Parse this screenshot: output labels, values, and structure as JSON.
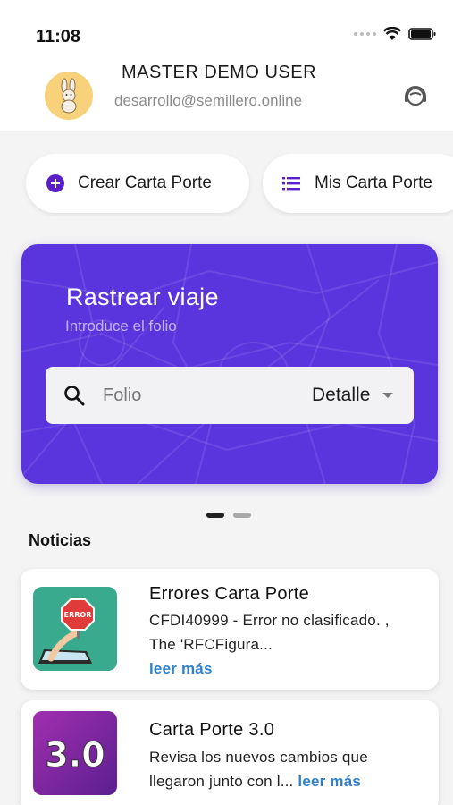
{
  "status_bar": {
    "time": "11:08"
  },
  "user": {
    "name": "MASTER DEMO USER",
    "email": "desarrollo@semillero.online"
  },
  "actions": {
    "create_label": "Crear Carta Porte",
    "list_label": "Mis Carta Porte"
  },
  "track": {
    "title": "Rastrear viaje",
    "subtitle": "Introduce el folio",
    "search_placeholder": "Folio",
    "detail_label": "Detalle"
  },
  "carousel": {
    "active_index": 0,
    "count": 2
  },
  "news": {
    "heading": "Noticias",
    "items": [
      {
        "title": "Errores Carta Porte",
        "body": "CFDI40999 - Error no clasificado. , The 'RFCFigura...",
        "read_more": "leer más",
        "thumb_text": "ERROR"
      },
      {
        "title": "Carta Porte 3.0",
        "body": "Revisa los nuevos cambios que llegaron junto con l...",
        "read_more": "leer más",
        "thumb_text": "3.0"
      }
    ]
  },
  "colors": {
    "accent": "#5a35de",
    "link": "#2f80c8",
    "avatar_bg": "#f7d27a"
  },
  "icons": [
    "wifi-icon",
    "battery-icon",
    "rabbit-avatar-icon",
    "support-agent-icon",
    "add-circle-icon",
    "list-icon",
    "search-icon",
    "dropdown-caret-icon"
  ]
}
